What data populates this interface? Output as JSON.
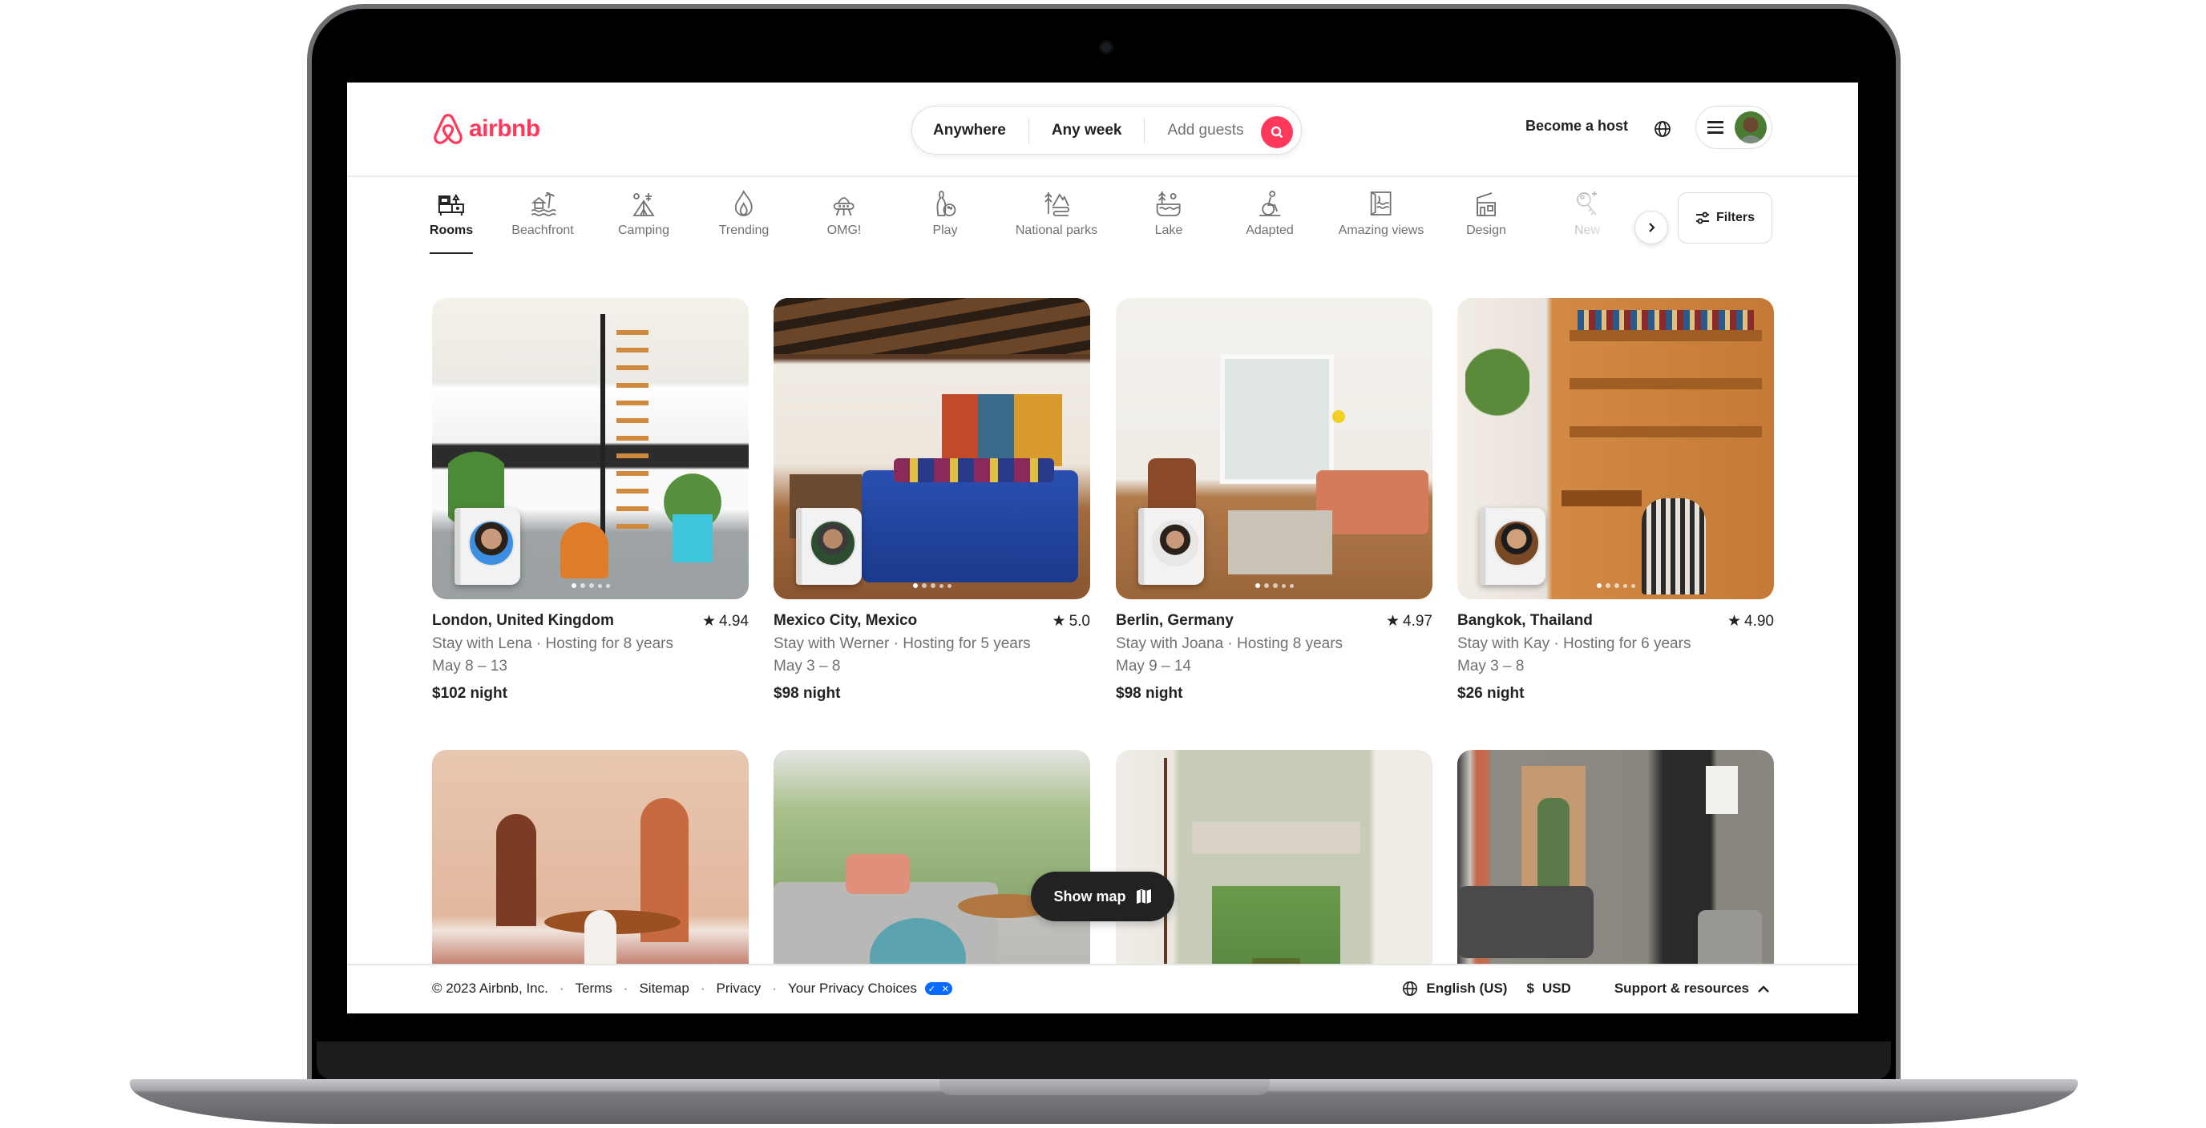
{
  "brand": {
    "name": "airbnb",
    "color": "#ff385c"
  },
  "header": {
    "search": {
      "location": "Anywhere",
      "dates": "Any week",
      "guests_placeholder": "Add guests"
    },
    "become_host": "Become a host"
  },
  "categories": {
    "items": [
      {
        "label": "Rooms",
        "icon": "rooms-icon",
        "active": true
      },
      {
        "label": "Beachfront",
        "icon": "beachfront-icon"
      },
      {
        "label": "Camping",
        "icon": "camping-icon"
      },
      {
        "label": "Trending",
        "icon": "trending-flame-icon"
      },
      {
        "label": "OMG!",
        "icon": "ufo-icon"
      },
      {
        "label": "Play",
        "icon": "bowling-icon"
      },
      {
        "label": "National parks",
        "icon": "national-parks-icon"
      },
      {
        "label": "Lake",
        "icon": "lake-icon"
      },
      {
        "label": "Adapted",
        "icon": "wheelchair-icon"
      },
      {
        "label": "Amazing views",
        "icon": "amazing-views-icon"
      },
      {
        "label": "Design",
        "icon": "design-icon"
      },
      {
        "label": "New",
        "icon": "new-key-icon"
      }
    ],
    "filters_label": "Filters"
  },
  "listings": [
    {
      "location": "London, United Kingdom",
      "rating": "4.94",
      "host_line": "Stay with Lena · Hosting for 8 years",
      "dates": "May 8 – 13",
      "price": "$102 night"
    },
    {
      "location": "Mexico City, Mexico",
      "rating": "5.0",
      "host_line": "Stay with Werner · Hosting for 5 years",
      "dates": "May 3 – 8",
      "price": "$98 night"
    },
    {
      "location": "Berlin, Germany",
      "rating": "4.97",
      "host_line": "Stay with Joana · Hosting 8 years",
      "dates": "May 9 – 14",
      "price": "$98 night"
    },
    {
      "location": "Bangkok, Thailand",
      "rating": "4.90",
      "host_line": "Stay with Kay · Hosting for 6 years",
      "dates": "May 3 – 8",
      "price": "$26 night"
    }
  ],
  "show_map": "Show map",
  "footer": {
    "copyright": "© 2023 Airbnb, Inc.",
    "links": [
      "Terms",
      "Sitemap",
      "Privacy",
      "Your Privacy Choices"
    ],
    "language": "English (US)",
    "currency_symbol": "$",
    "currency": "USD",
    "support": "Support & resources"
  }
}
